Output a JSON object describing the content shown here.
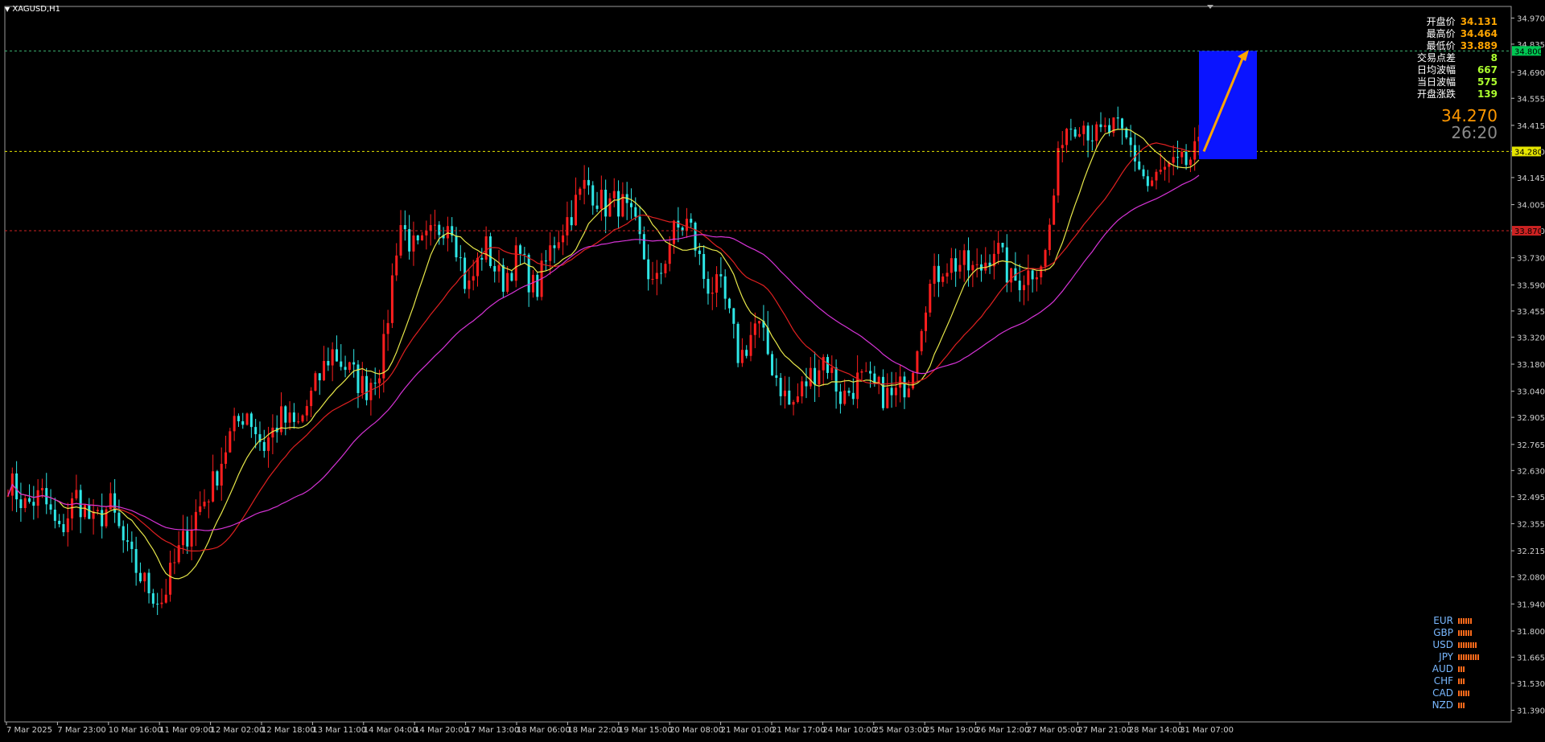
{
  "window": {
    "symbol_label": "XAGUSD,H1"
  },
  "info_panel": {
    "rows": [
      {
        "label": "开盘价",
        "value": "34.131",
        "color": "#ffa500"
      },
      {
        "label": "最高价",
        "value": "34.464",
        "color": "#ffa500"
      },
      {
        "label": "最低价",
        "value": "33.889",
        "color": "#ffa500"
      },
      {
        "label": "交易点差",
        "value": "8",
        "color": "#adff2f"
      },
      {
        "label": "日均波幅",
        "value": "667",
        "color": "#adff2f"
      },
      {
        "label": "当日波幅",
        "value": "575",
        "color": "#adff2f"
      },
      {
        "label": "开盘涨跌",
        "value": "139",
        "color": "#adff2f"
      }
    ],
    "current_price": "34.270",
    "countdown": "26:20"
  },
  "currency_strength": [
    {
      "name": "EUR",
      "bars": 6
    },
    {
      "name": "GBP",
      "bars": 6
    },
    {
      "name": "USD",
      "bars": 8
    },
    {
      "name": "JPY",
      "bars": 9
    },
    {
      "name": "AUD",
      "bars": 3
    },
    {
      "name": "CHF",
      "bars": 3
    },
    {
      "name": "CAD",
      "bars": 5
    },
    {
      "name": "NZD",
      "bars": 3
    }
  ],
  "chart_data": {
    "type": "candlestick",
    "title": "XAGUSD,H1",
    "ylim": [
      31.33,
      35.03
    ],
    "y_ticks": [
      "34.970",
      "34.835",
      "34.690",
      "34.555",
      "34.415",
      "34.280",
      "34.145",
      "34.005",
      "33.870",
      "33.730",
      "33.590",
      "33.455",
      "33.320",
      "33.180",
      "33.040",
      "32.905",
      "32.765",
      "32.630",
      "32.495",
      "32.355",
      "32.215",
      "32.080",
      "31.940",
      "31.800",
      "31.665",
      "31.530",
      "31.390"
    ],
    "x_labels": [
      "7 Mar 2025",
      "7 Mar 23:00",
      "10 Mar 16:00",
      "11 Mar 09:00",
      "12 Mar 02:00",
      "12 Mar 18:00",
      "13 Mar 11:00",
      "14 Mar 04:00",
      "14 Mar 20:00",
      "17 Mar 13:00",
      "18 Mar 06:00",
      "18 Mar 22:00",
      "19 Mar 15:00",
      "20 Mar 08:00",
      "21 Mar 01:00",
      "21 Mar 17:00",
      "24 Mar 10:00",
      "25 Mar 03:00",
      "25 Mar 19:00",
      "26 Mar 12:00",
      "27 Mar 05:00",
      "27 Mar 21:00",
      "28 Mar 14:00",
      "31 Mar 07:00"
    ],
    "price_path": [
      32.58,
      32.45,
      32.5,
      32.3,
      32.5,
      32.35,
      32.45,
      32.2,
      32.05,
      31.95,
      32.2,
      32.4,
      32.55,
      32.8,
      32.95,
      32.75,
      32.9,
      32.85,
      33.05,
      33.25,
      33.15,
      33.05,
      33.2,
      33.92,
      33.75,
      33.85,
      33.95,
      33.55,
      33.8,
      33.6,
      33.75,
      33.55,
      33.8,
      33.95,
      34.12,
      34.0,
      34.02,
      33.85,
      33.55,
      33.85,
      33.92,
      33.6,
      33.55,
      33.2,
      33.4,
      33.15,
      32.95,
      33.1,
      33.22,
      33.0,
      33.1,
      33.05,
      33.0,
      33.12,
      33.55,
      33.7,
      33.7,
      33.65,
      33.8,
      33.6,
      33.65,
      33.75,
      34.4,
      34.45,
      34.35,
      34.4,
      34.3,
      34.1,
      34.18,
      34.2,
      34.28
    ],
    "candle_count": 280,
    "series": [
      {
        "name": "MA fast",
        "color": "#e8e84a"
      },
      {
        "name": "MA medium",
        "color": "#e02020"
      },
      {
        "name": "MA slow",
        "color": "#d633d6"
      }
    ],
    "horizontal_levels": [
      {
        "value": 34.8,
        "label": "34.800",
        "color": "#3cb371",
        "label_bg": "#00c853",
        "style": "dashed"
      },
      {
        "value": 34.28,
        "label": "34.280",
        "color": "#e6e600",
        "label_bg": "#e6e600",
        "style": "dashed"
      },
      {
        "value": 33.87,
        "label": "33.870",
        "color": "#cc2222",
        "label_bg": "#cc2222",
        "style": "dashed"
      }
    ],
    "target_box": {
      "color": "#0a14ff"
    },
    "target_arrow": {
      "from": 34.28,
      "to": 34.78,
      "color": "#ffa500"
    }
  }
}
